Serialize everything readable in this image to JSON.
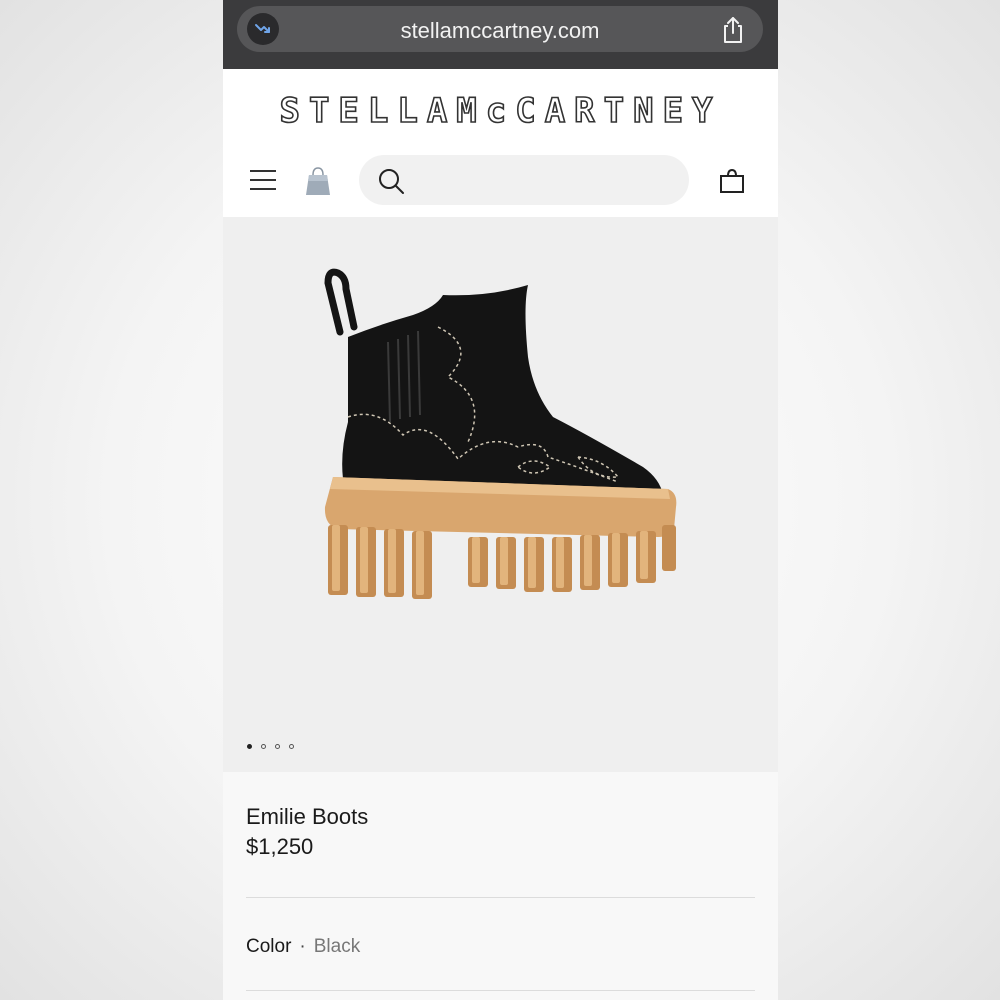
{
  "browser": {
    "url": "stellamccartney.com"
  },
  "header": {
    "logo_text": "STELLAMcCARTNEY",
    "search": {
      "placeholder": ""
    }
  },
  "gallery": {
    "image_alt": "Emilie Boots",
    "dots": [
      true,
      false,
      false,
      false
    ]
  },
  "product": {
    "name": "Emilie Boots",
    "price": "$1,250",
    "color_label": "Color",
    "color_separator": "·",
    "color_value": "Black"
  },
  "colors": {
    "browser_bar": "#3b3b3d",
    "boot_leather": "#141414",
    "sole": "#d9a66e"
  },
  "icons": [
    "trending-icon",
    "share-icon",
    "menu-icon",
    "bag-icon",
    "search-icon",
    "cart-icon"
  ]
}
